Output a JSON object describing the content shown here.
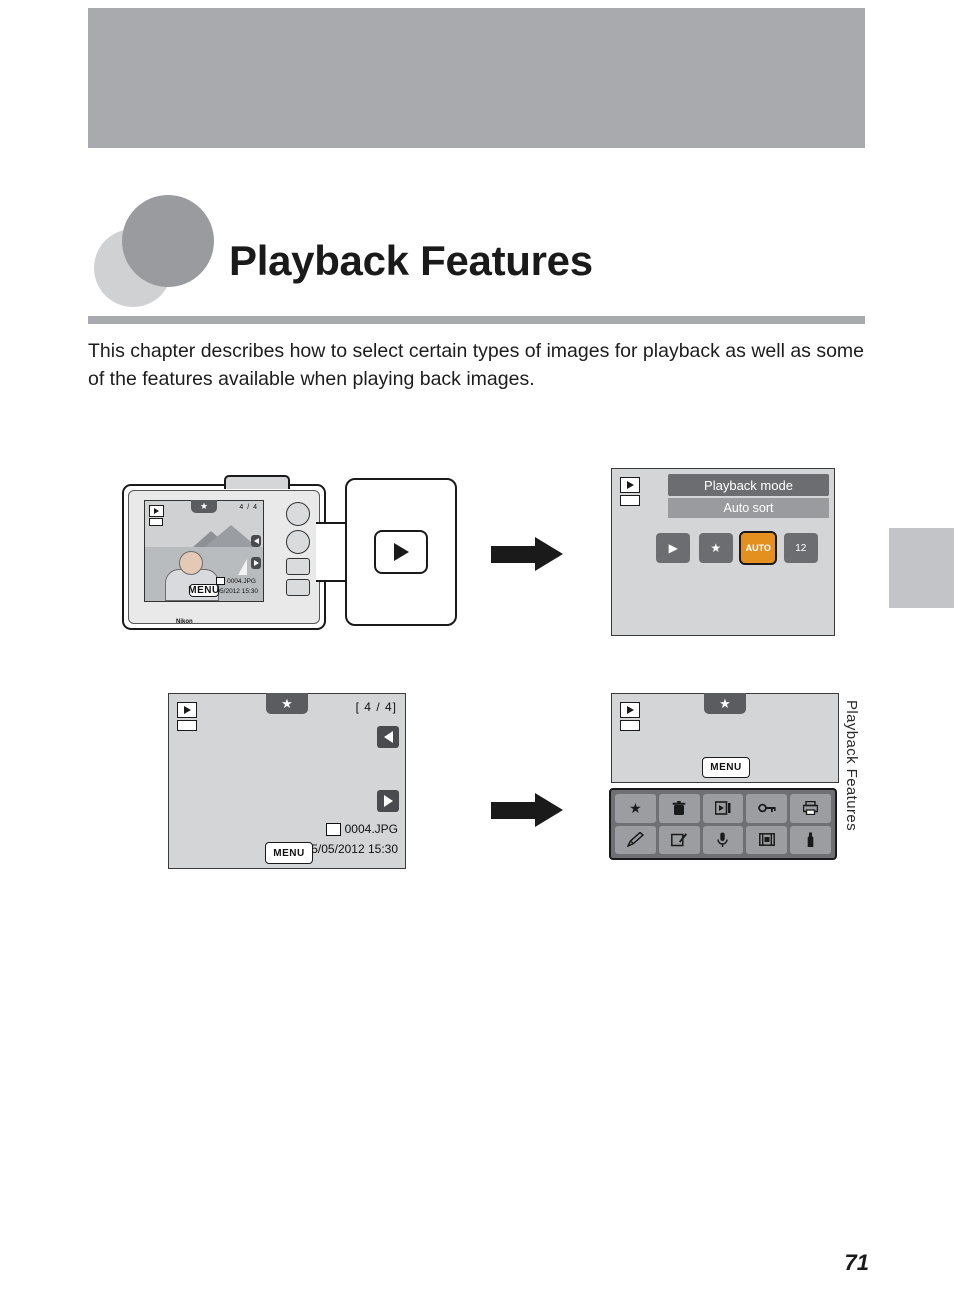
{
  "page": {
    "chapter_title": "Playback Features",
    "intro": "This chapter describes how to select certain types of images for playback as well as some of the features available when playing back images.",
    "side_tab_label": "Playback Features",
    "page_number": "71"
  },
  "figures": {
    "camera": {
      "brand": "Nikon",
      "menu_label": "MENU",
      "counter": "4 / 4",
      "file_name": "0004.JPG",
      "date_time": "15/05/2012  15:30"
    },
    "callout": {
      "button_name": "playback-button"
    },
    "playback_mode_screen": {
      "title": "Playback mode",
      "selected_option": "Auto sort",
      "icons": [
        {
          "name": "playback-icon",
          "label": "▶"
        },
        {
          "name": "favorites-icon",
          "label": "★"
        },
        {
          "name": "auto-sort-icon",
          "label": "AUTO"
        },
        {
          "name": "list-by-date-icon",
          "label": "12"
        }
      ]
    },
    "image_screen": {
      "counter": "[    4 /    4]",
      "file_name": "0004.JPG",
      "date_time": "15/05/2012  15:30",
      "menu_label": "MENU"
    },
    "options_screen": {
      "menu_label": "MENU",
      "options": [
        {
          "name": "favorites-icon",
          "label": "★"
        },
        {
          "name": "delete-icon",
          "label": "🗑"
        },
        {
          "name": "slide-show-icon",
          "label": "▶"
        },
        {
          "name": "protect-icon",
          "label": "⚷"
        },
        {
          "name": "print-order-icon",
          "label": "⎙"
        },
        {
          "name": "quick-retouch-icon",
          "label": "✎"
        },
        {
          "name": "glamour-retouch-icon",
          "label": "✍"
        },
        {
          "name": "voice-memo-icon",
          "label": "🎤"
        },
        {
          "name": "small-picture-icon",
          "label": "⊞"
        },
        {
          "name": "setup-icon",
          "label": "🔧"
        }
      ]
    }
  }
}
